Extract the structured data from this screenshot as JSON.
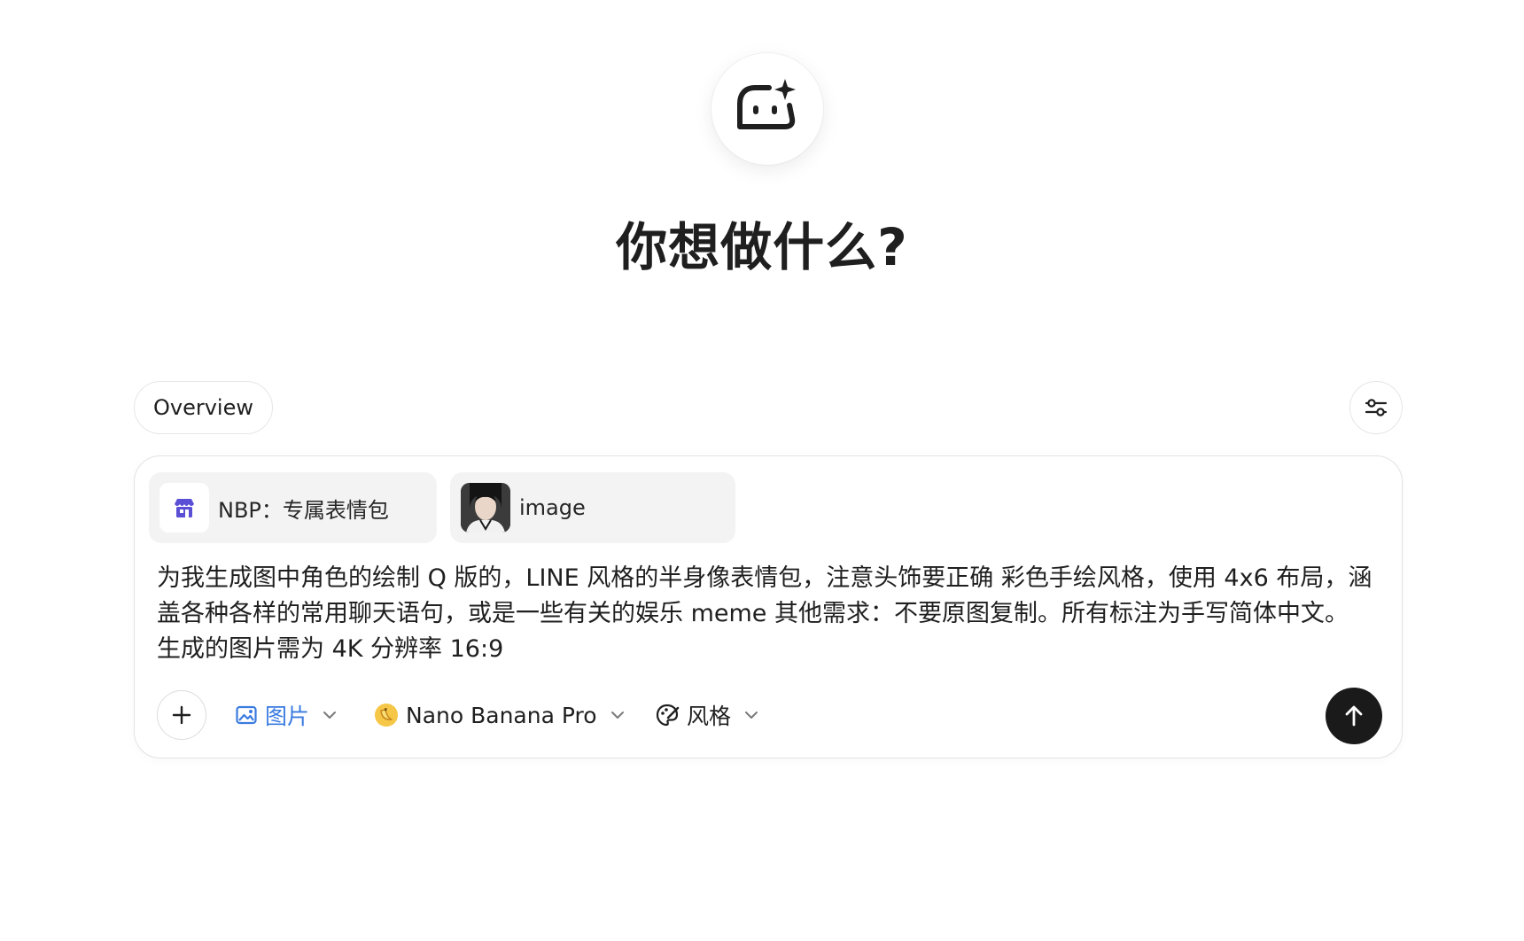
{
  "hero": {
    "logo_icon": "bot-sparkle-icon",
    "headline": "你想做什么?"
  },
  "tabs": [
    {
      "label": "Overview",
      "active": true
    }
  ],
  "settings_icon": "sliders-icon",
  "composer": {
    "attachments": [
      {
        "icon": "store-icon",
        "label": "NBP：专属表情包"
      },
      {
        "icon": "portrait-thumbnail",
        "label": "image"
      }
    ],
    "prompt": "为我生成图中角色的绘制 Q 版的，LINE 风格的半身像表情包，注意头饰要正确 彩色手绘风格，使用 4x6 布局，涵盖各种各样的常用聊天语句，或是一些有关的娱乐 meme 其他需求：不要原图复制。所有标注为手写简体中文。 生成的图片需为 4K 分辨率 16:9",
    "toolbar": {
      "add_icon": "plus-icon",
      "type_label": "图片",
      "type_icon": "image-icon",
      "model_label": "Nano Banana Pro",
      "model_icon": "banana-icon",
      "style_label": "风格",
      "style_icon": "palette-icon",
      "send_icon": "arrow-up-icon"
    }
  },
  "colors": {
    "accent_blue": "#3a7be0",
    "send_button": "#1a1a1a",
    "chip_bg": "#f3f3f3",
    "store_icon": "#5b4fd6"
  }
}
